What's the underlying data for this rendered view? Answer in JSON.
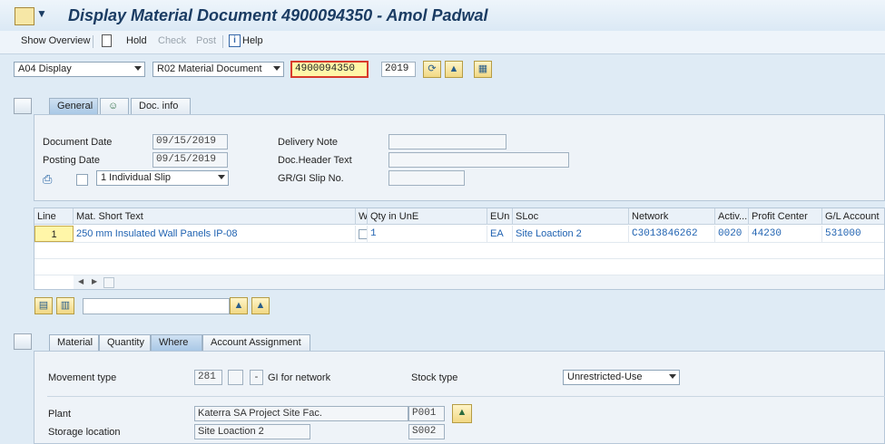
{
  "window": {
    "title": "Display Material Document 4900094350 - Amol Padwal"
  },
  "toolbar": {
    "show_overview": "Show Overview",
    "hold": "Hold",
    "check": "Check",
    "post": "Post",
    "help": "Help",
    "icons": [
      "document-icon",
      "info-icon"
    ]
  },
  "header_controls": {
    "action": "A04 Display",
    "reference": "R02 Material Document",
    "doc_number": "4900094350",
    "year": "2019"
  },
  "header_tabs": [
    "General",
    "Doc. info"
  ],
  "general": {
    "document_date_label": "Document Date",
    "document_date": "09/15/2019",
    "posting_date_label": "Posting Date",
    "posting_date": "09/15/2019",
    "slip_option": "1 Individual Slip",
    "delivery_note_label": "Delivery Note",
    "doc_header_text_label": "Doc.Header Text",
    "grgi_slip_label": "GR/GI Slip No."
  },
  "items_table": {
    "columns": [
      "Line",
      "Mat. Short Text",
      "W",
      "Qty in UnE",
      "EUn",
      "SLoc",
      "Network",
      "Activ...",
      "Profit Center",
      "G/L Account"
    ],
    "rows": [
      {
        "line": "1",
        "text": "250 mm Insulated Wall Panels IP-08",
        "qty": "1",
        "eun": "EA",
        "sloc": "Site Loaction 2",
        "network": "C3013846262",
        "activity": "0020",
        "profit_center": "44230",
        "gl_account": "531000"
      }
    ]
  },
  "item_tabs": [
    "Material",
    "Quantity",
    "Where",
    "Account Assignment"
  ],
  "where": {
    "movement_type_label": "Movement type",
    "movement_type": "281",
    "movement_dash": "-",
    "movement_desc": "GI for network",
    "stock_type_label": "Stock type",
    "stock_type": "Unrestricted-Use",
    "plant_label": "Plant",
    "plant_name": "Katerra SA Project Site Fac.",
    "plant_code": "P001",
    "storage_location_label": "Storage location",
    "storage_location_name": "Site Loaction 2",
    "storage_location_code": "S002"
  },
  "colors": {
    "accent": "#1f62b1",
    "title": "#1b3c63",
    "highlight_field": "#fff6a8"
  }
}
